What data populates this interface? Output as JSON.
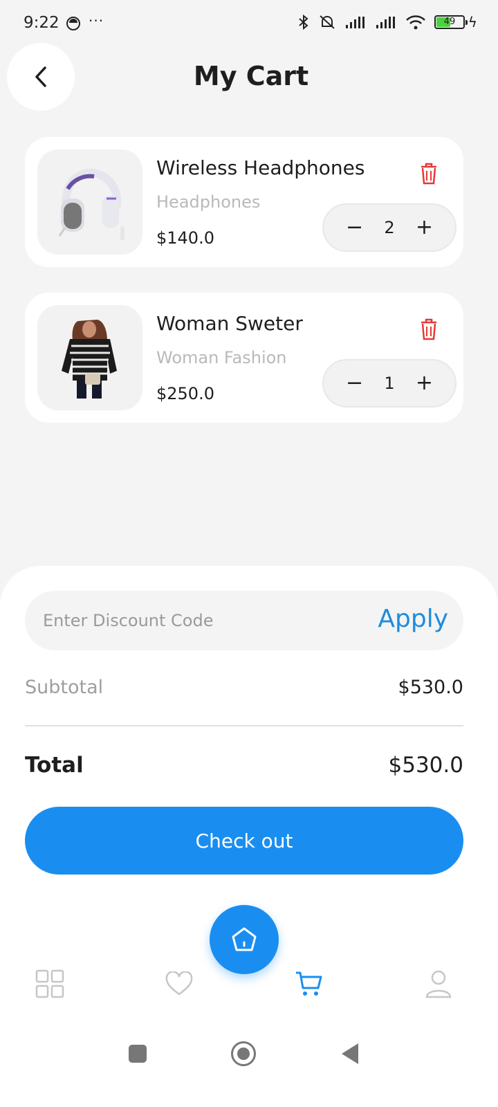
{
  "status_bar": {
    "time": "9:22",
    "dots": "···",
    "battery_level": "49",
    "icons": [
      "bluetooth-icon",
      "mute-icon",
      "signal-icon",
      "signal-icon",
      "wifi-icon",
      "battery-icon",
      "charging-icon"
    ]
  },
  "header": {
    "title": "My Cart",
    "back_icon": "chevron-left-icon"
  },
  "cart": {
    "items": [
      {
        "name": "Wireless Headphones",
        "category": "Headphones",
        "price": "$140.0",
        "quantity": "2",
        "minus": "−",
        "plus": "+",
        "image": "headphones-image"
      },
      {
        "name": "Woman Sweter",
        "category": "Woman Fashion",
        "price": "$250.0",
        "quantity": "1",
        "minus": "−",
        "plus": "+",
        "image": "sweater-image"
      }
    ]
  },
  "summary": {
    "discount_placeholder": "Enter Discount Code",
    "apply_label": "Apply",
    "subtotal_label": "Subtotal",
    "subtotal_value": "$530.0",
    "total_label": "Total",
    "total_value": "$530.0",
    "checkout_label": "Check out"
  },
  "bottom_nav": {
    "items": [
      "grid-icon",
      "heart-icon",
      "home-icon",
      "cart-icon",
      "profile-icon"
    ],
    "active": "cart-icon"
  },
  "colors": {
    "accent": "#1a8ef0",
    "danger": "#e53935",
    "background": "#f4f4f4",
    "muted": "#9e9e9e"
  }
}
